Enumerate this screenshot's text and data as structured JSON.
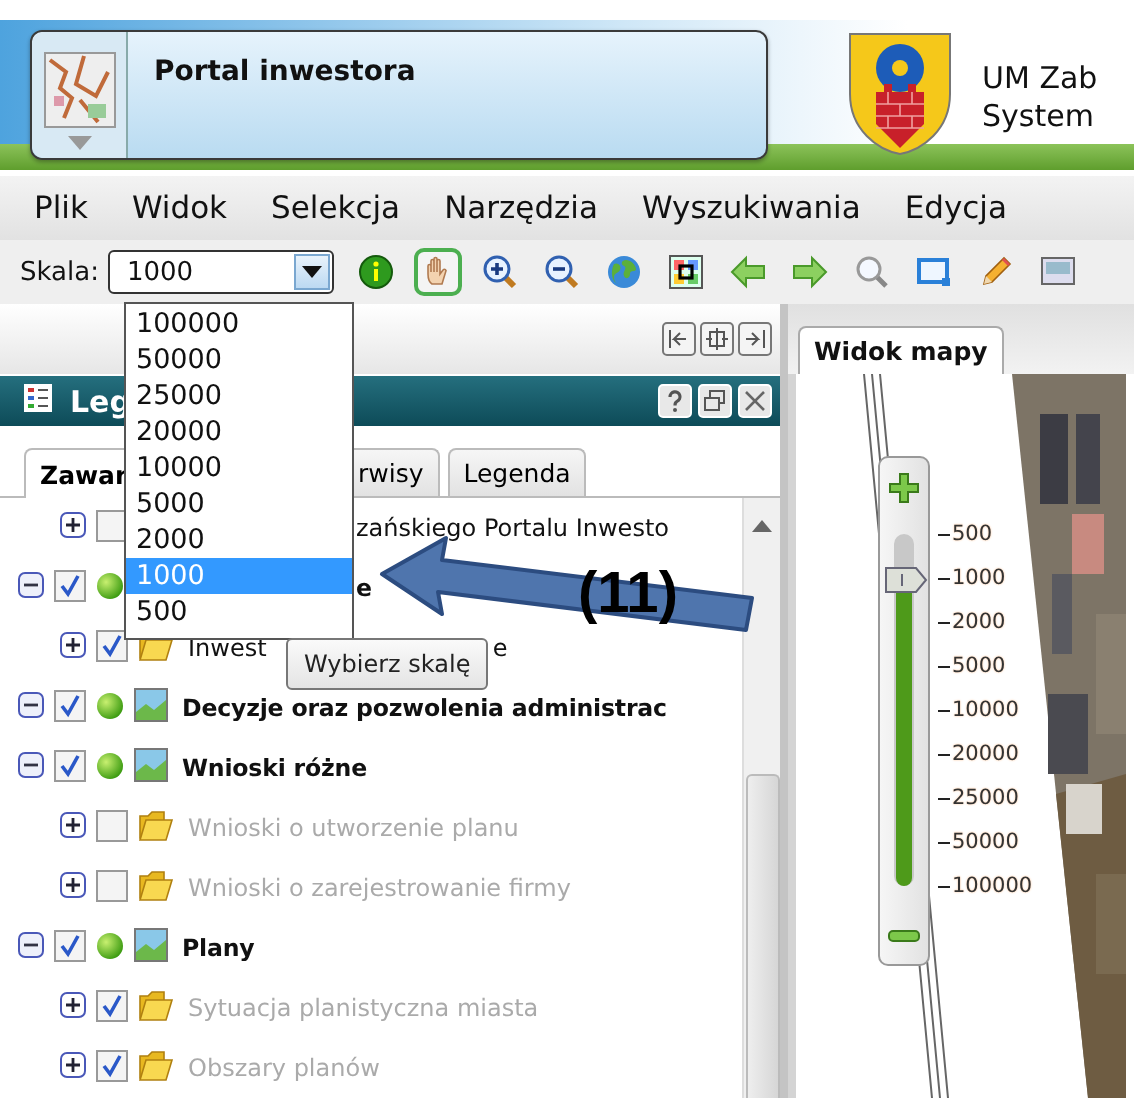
{
  "header": {
    "title": "Portal inwestora",
    "org_lines": [
      "UM Zab",
      "System"
    ]
  },
  "menu": [
    "Plik",
    "Widok",
    "Selekcja",
    "Narzędzia",
    "Wyszukiwania",
    "Edycja"
  ],
  "toolbar": {
    "scale_label": "Skala:",
    "scale_value": "1000",
    "tools": [
      {
        "kind": "info",
        "selected": false
      },
      {
        "kind": "pan",
        "selected": true
      },
      {
        "kind": "zoom-in",
        "selected": false
      },
      {
        "kind": "zoom-out",
        "selected": false
      },
      {
        "kind": "globe",
        "selected": false
      },
      {
        "kind": "extent",
        "selected": false
      },
      {
        "kind": "back",
        "selected": false
      },
      {
        "kind": "forward",
        "selected": false
      },
      {
        "kind": "search",
        "selected": false
      },
      {
        "kind": "rectangle",
        "selected": false
      },
      {
        "kind": "pencil",
        "selected": false
      },
      {
        "kind": "layer",
        "selected": false
      }
    ]
  },
  "legend_panel": {
    "title": "Leg",
    "tabs": [
      {
        "label": "Zawar",
        "selected": true
      },
      {
        "label": "rwisy",
        "selected": false
      },
      {
        "label": "Legenda",
        "selected": false
      }
    ],
    "tree": [
      {
        "kind": "continued",
        "children": [
          {
            "kind": "layer",
            "parts": [
              "zańskiego Portalu Inwesto"
            ],
            "hidden_start": true,
            "expanded": false,
            "checked": false,
            "dimmed": false
          }
        ]
      },
      {
        "kind": "group",
        "parts": [
          "e"
        ],
        "hidden_start": true,
        "expanded": true,
        "checked": true,
        "dimmed": false,
        "children": [
          {
            "kind": "layer",
            "parts": [
              "Inwest",
              "e"
            ],
            "expanded": false,
            "checked": true,
            "dimmed": false
          }
        ]
      },
      {
        "kind": "group",
        "parts": [
          "Decyzje oraz pozwolenia administrac"
        ],
        "expanded": true,
        "checked": true,
        "dimmed": false
      },
      {
        "kind": "group",
        "parts": [
          "Wnioski różne"
        ],
        "expanded": true,
        "checked": true,
        "dimmed": false,
        "children": [
          {
            "kind": "layer",
            "parts": [
              "Wnioski o utworzenie planu"
            ],
            "expanded": false,
            "checked": false,
            "dimmed": true
          },
          {
            "kind": "layer",
            "parts": [
              "Wnioski o zarejestrowanie firmy"
            ],
            "expanded": false,
            "checked": false,
            "dimmed": true
          }
        ]
      },
      {
        "kind": "group",
        "parts": [
          "Plany"
        ],
        "expanded": true,
        "checked": true,
        "dimmed": false,
        "children": [
          {
            "kind": "layer",
            "parts": [
              "Sytuacja planistyczna miasta"
            ],
            "expanded": false,
            "checked": true,
            "dimmed": true
          },
          {
            "kind": "layer",
            "parts": [
              "Obszary planów"
            ],
            "expanded": false,
            "checked": true,
            "dimmed": true
          }
        ]
      }
    ]
  },
  "map_panel": {
    "tab": {
      "label": "Widok mapy",
      "selected": true
    },
    "zoom": {
      "level": 0.875,
      "ticks": [
        "500",
        "1000",
        "2000",
        "5000",
        "10000",
        "20000",
        "25000",
        "50000",
        "100000"
      ]
    }
  },
  "scale_dropdown": {
    "options": [
      {
        "label": "100000",
        "selected": false
      },
      {
        "label": "50000",
        "selected": false
      },
      {
        "label": "25000",
        "selected": false
      },
      {
        "label": "20000",
        "selected": false
      },
      {
        "label": "10000",
        "selected": false
      },
      {
        "label": "5000",
        "selected": false
      },
      {
        "label": "2000",
        "selected": false
      },
      {
        "label": "1000",
        "selected": true
      },
      {
        "label": "500",
        "selected": false
      }
    ]
  },
  "tooltip": "Wybierz skalę",
  "annotation": {
    "label": "(11)"
  }
}
